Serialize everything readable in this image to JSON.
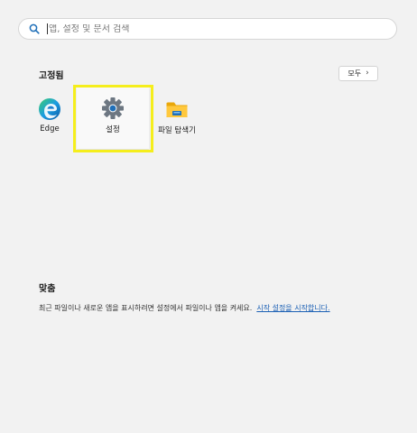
{
  "search": {
    "placeholder": "앱, 설정 및 문서 검색",
    "value": ""
  },
  "pinned": {
    "title": "고정됨",
    "all_button_label": "모두",
    "all_button_chevron": "›",
    "apps": [
      {
        "label": "Edge",
        "icon": "edge-icon"
      },
      {
        "label": "설정",
        "icon": "gear-icon",
        "highlighted": true
      },
      {
        "label": "파일 탐색기",
        "icon": "folder-icon"
      }
    ]
  },
  "recommended": {
    "title": "맞춤",
    "message": "최근 파일이나 새로운 앱을 표시하려면 설정에서 파일이나 앱을 켜세요.",
    "link_text": "시작 설정을 시작합니다."
  },
  "colors": {
    "highlight": "#f5ee1c",
    "link": "#1a5fb4",
    "background": "#f2f2f2"
  }
}
